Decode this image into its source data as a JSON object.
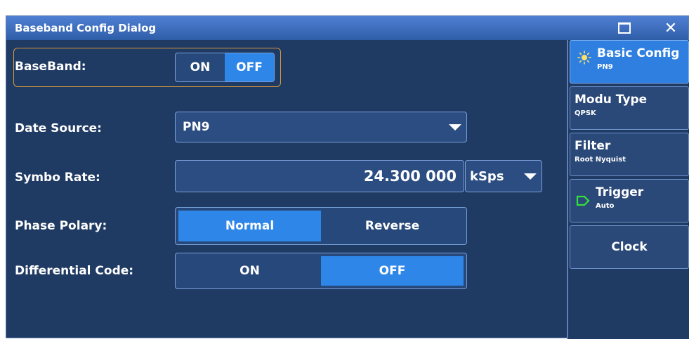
{
  "dialog": {
    "title": "Baseband Config Dialog",
    "maximize_icon": "maximize-icon",
    "close_glyph": "✕"
  },
  "baseband": {
    "label": "BaseBand:",
    "options": [
      "ON",
      "OFF"
    ],
    "selected": "OFF"
  },
  "data_source": {
    "label": "Date Source:",
    "value": "PN9"
  },
  "symbol_rate": {
    "label": "Symbo Rate:",
    "value": "24.300 000",
    "unit": "kSps"
  },
  "phase_polarity": {
    "label": "Phase Polary:",
    "options": [
      "Normal",
      "Reverse"
    ],
    "selected": "Normal"
  },
  "differential_code": {
    "label": "Differential Code:",
    "options": [
      "ON",
      "OFF"
    ],
    "selected": "OFF"
  },
  "sidebar": {
    "items": [
      {
        "title": "Basic Config",
        "sub": "PN9",
        "icon": "sun-icon",
        "active": true
      },
      {
        "title": "Modu Type",
        "sub": "QPSK"
      },
      {
        "title": "Filter",
        "sub": "Root Nyquist"
      },
      {
        "title": "Trigger",
        "sub": "Auto",
        "icon": "trigger-tag-icon"
      },
      {
        "title": "Clock",
        "sub": ""
      }
    ]
  },
  "colors": {
    "dialog_bg": "#1f3a63",
    "accent": "#2e86e8",
    "focus_border": "#d99a3e",
    "trigger_icon": "#34e03a"
  }
}
